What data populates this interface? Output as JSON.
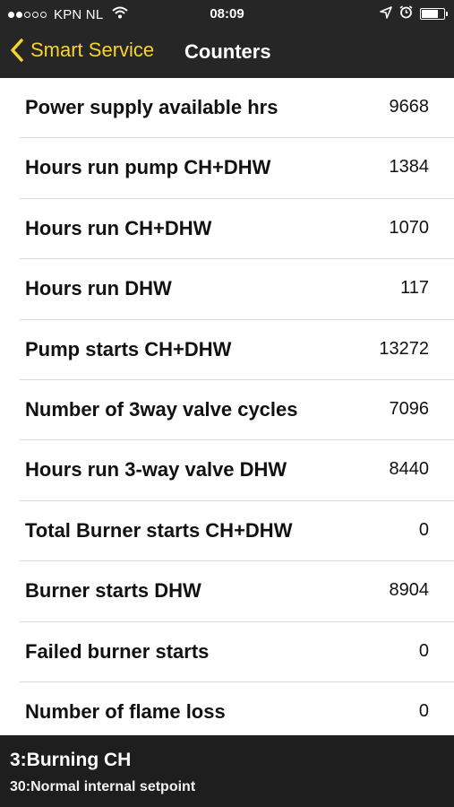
{
  "status_bar": {
    "signal_dots_filled": 2,
    "signal_dots_total": 5,
    "carrier": "KPN NL",
    "time": "08:09",
    "icons": [
      "wifi-icon",
      "location-icon",
      "alarm-icon",
      "battery-icon"
    ]
  },
  "nav": {
    "back_label": "Smart Service",
    "title": "Counters",
    "accent_color": "#f6d32d"
  },
  "counters": [
    {
      "label": "Power supply available hrs",
      "value": "9668"
    },
    {
      "label": "Hours run pump CH+DHW",
      "value": "1384"
    },
    {
      "label": "Hours run CH+DHW",
      "value": "1070"
    },
    {
      "label": "Hours run DHW",
      "value": "117"
    },
    {
      "label": "Pump starts CH+DHW",
      "value": "13272"
    },
    {
      "label": "Number of 3way valve cycles",
      "value": "7096"
    },
    {
      "label": "Hours run 3-way valve DHW",
      "value": "8440"
    },
    {
      "label": "Total Burner starts CH+DHW",
      "value": "0"
    },
    {
      "label": "Burner starts DHW",
      "value": "8904"
    },
    {
      "label": "Failed burner starts",
      "value": "0"
    },
    {
      "label": "Number of flame loss",
      "value": "0"
    }
  ],
  "footer": {
    "status": "3:Burning CH",
    "substatus": "30:Normal internal setpoint"
  }
}
